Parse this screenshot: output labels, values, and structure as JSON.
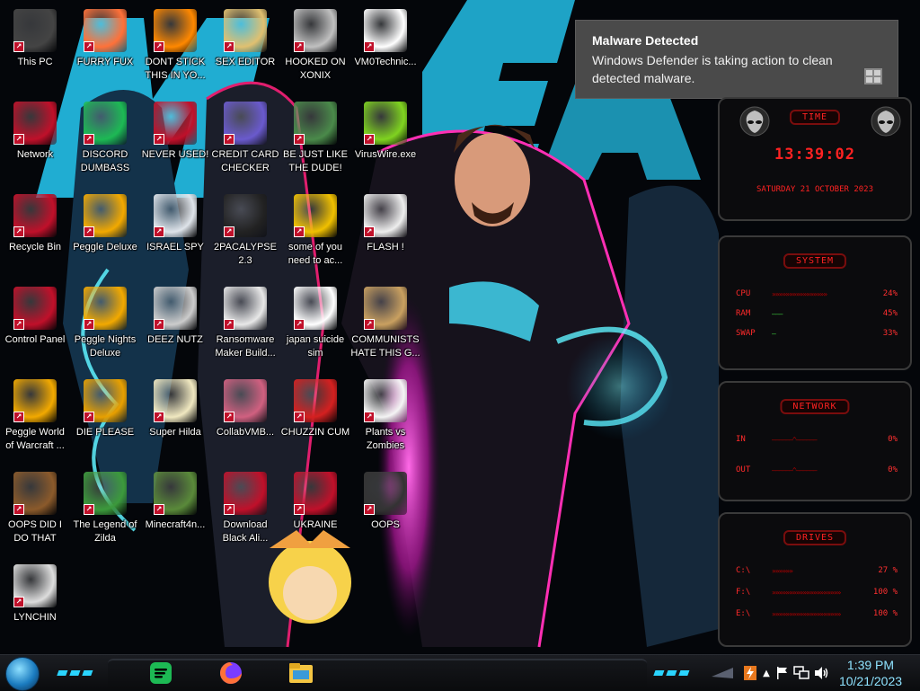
{
  "desktop_icons": [
    {
      "label": "This PC",
      "icon": "computer-icon",
      "color": "#444444"
    },
    {
      "label": "FURRY FUX",
      "icon": "firefox-icon",
      "color": "#ff7139"
    },
    {
      "label": "DONT STICK THIS IN YO...",
      "icon": "vlc-cone-icon",
      "color": "#ff8800"
    },
    {
      "label": "SEX EDITOR",
      "icon": "hex-editor-icon",
      "color": "#e0c070"
    },
    {
      "label": "HOOKED ON XONIX",
      "icon": "xonix-game-icon",
      "color": "#c0c0c0"
    },
    {
      "label": "VM0Technic...",
      "icon": "doctor-icon",
      "color": "#ffffff"
    },
    {
      "label": "Network",
      "icon": "network-orb-icon",
      "color": "#c0102a"
    },
    {
      "label": "DISCORD DUMBASS",
      "icon": "chat-app-icon",
      "color": "#1db954"
    },
    {
      "label": "NEVER USED!",
      "icon": "devcpp-icon",
      "color": "#c0102a"
    },
    {
      "label": "CREDIT CARD CHECKER",
      "icon": "credit-card-icon",
      "color": "#6a5acd"
    },
    {
      "label": "BE JUST LIKE THE DUDE!",
      "icon": "santa-icon",
      "color": "#4a8a4a"
    },
    {
      "label": "VirusWire.exe",
      "icon": "lime-icon",
      "color": "#7fd320"
    },
    {
      "label": "Recycle Bin",
      "icon": "recycle-bin-icon",
      "color": "#c0102a"
    },
    {
      "label": "Peggle Deluxe",
      "icon": "peggle-icon",
      "color": "#f2a900"
    },
    {
      "label": "ISRAEL SPY",
      "icon": "spy-computer-icon",
      "color": "#dfe4ea"
    },
    {
      "label": "2PACALYPSE 2.3",
      "icon": "terminal-icon",
      "color": "#222222"
    },
    {
      "label": "some of you need to ac...",
      "icon": "beaver-icon",
      "color": "#f0c000"
    },
    {
      "label": "FLASH !",
      "icon": "document-icon",
      "color": "#eeeeee"
    },
    {
      "label": "Control Panel",
      "icon": "control-panel-icon",
      "color": "#c0102a"
    },
    {
      "label": "Peggle Nights Deluxe",
      "icon": "peggle-icon",
      "color": "#f2a900"
    },
    {
      "label": "DEEZ NUTZ",
      "icon": "windows-stack-icon",
      "color": "#cccccc"
    },
    {
      "label": "Ransomware Maker Build...",
      "icon": "app-window-icon",
      "color": "#e8e8e8"
    },
    {
      "label": "japan suicide sim",
      "icon": "file-icon",
      "color": "#ffffff"
    },
    {
      "label": "COMMUNISTS HATE THIS G...",
      "icon": "money-bag-icon",
      "color": "#c9a060"
    },
    {
      "label": "Peggle World of Warcraft ...",
      "icon": "peggle-icon",
      "color": "#f2a900"
    },
    {
      "label": "DIE PLEASE",
      "icon": "de-icon",
      "color": "#e8a000"
    },
    {
      "label": "Super Hilda",
      "icon": "pixel-sprite-icon",
      "color": "#f0e8c0"
    },
    {
      "label": "CollabVMB...",
      "icon": "monitor-icon",
      "color": "#d06080"
    },
    {
      "label": "CHUZZIN CUM",
      "icon": "chuzzle-icon",
      "color": "#d42020"
    },
    {
      "label": "Plants vs Zombies",
      "icon": "plant-icon",
      "color": "#f4f4f4"
    },
    {
      "label": "OOPS DID I DO THAT",
      "icon": "portrait-icon",
      "color": "#8b5a2b"
    },
    {
      "label": "The Legend of Zilda",
      "icon": "pixel-hero-icon",
      "color": "#3c9a3c"
    },
    {
      "label": "Minecraft4n...",
      "icon": "grass-block-icon",
      "color": "#5a8a3a"
    },
    {
      "label": "Download Black Ali...",
      "icon": "network-orb-icon",
      "color": "#c0102a"
    },
    {
      "label": "UKRAINE",
      "icon": "radiation-icon",
      "color": "#c0102a"
    },
    {
      "label": "OOPS",
      "icon": "screen-icon",
      "color": "#333333"
    },
    {
      "label": "LYNCHIN",
      "icon": "gear-icon",
      "color": "#dddddd"
    }
  ],
  "notification": {
    "title": "Malware Detected",
    "body": "Windows Defender is taking action to clean detected malware."
  },
  "gadgets": {
    "time": {
      "title": "TIME",
      "clock": "13:39:02",
      "date": "SATURDAY 21 OCTOBER 2023"
    },
    "system": {
      "title": "SYSTEM",
      "rows": [
        {
          "name": "CPU",
          "value": "24%",
          "level": 0.24
        },
        {
          "name": "RAM",
          "value": "45%",
          "level": 0.45
        },
        {
          "name": "SWAP",
          "value": "33%",
          "level": 0.33
        }
      ]
    },
    "network": {
      "title": "NETWORK",
      "rows": [
        {
          "name": "IN",
          "value": "0%"
        },
        {
          "name": "OUT",
          "value": "0%"
        }
      ]
    },
    "drives": {
      "title": "DRIVES",
      "rows": [
        {
          "name": "C:\\",
          "value": "27 %"
        },
        {
          "name": "F:\\",
          "value": "100 %"
        },
        {
          "name": "E:\\",
          "value": "100 %"
        }
      ]
    }
  },
  "taskbar": {
    "pinned": [
      {
        "name": "spotify-icon",
        "color": "#1db954"
      },
      {
        "name": "firefox-icon",
        "color": "#ff7139"
      },
      {
        "name": "file-explorer-icon",
        "color": "#f4c542"
      }
    ],
    "tray": [
      "lightning-icon",
      "chevron-up-icon",
      "flag-icon",
      "network-icon",
      "volume-icon"
    ],
    "time": "1:39 PM",
    "date": "10/21/2023"
  },
  "colors": {
    "accent": "#e21a1a",
    "cyan": "#2ad4ff",
    "magenta": "#ff2fb4",
    "clock_text": "#8fe3ff"
  }
}
